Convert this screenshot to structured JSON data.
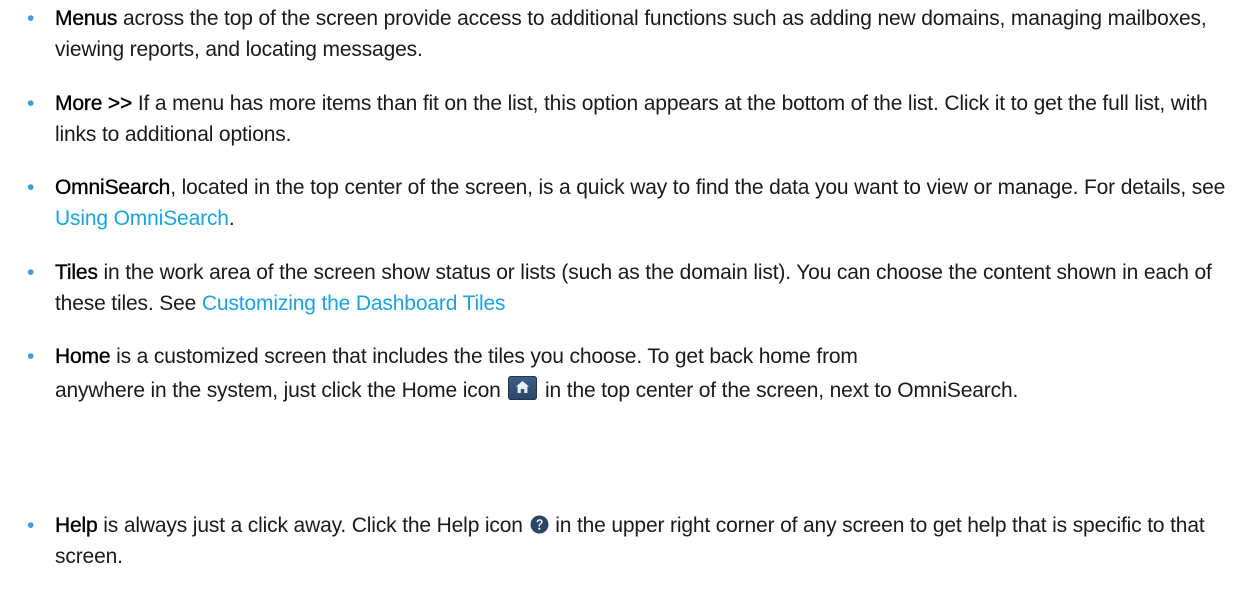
{
  "items": [
    {
      "term": "Menus",
      "text": " across the top of the screen provide access to additional functions such as adding new domains, managing mailboxes, viewing reports, and locating messages."
    },
    {
      "term": "More >>",
      "text": " If a menu has more items than fit on the list, this option appears at the bottom of the list. Click it to get the full list, with links to additional options."
    },
    {
      "term": "OmniSearch",
      "text": ", located in the top center of the screen, is a quick way to find the data you want to view or manage. For details, see ",
      "link": "Using OmniSearch",
      "after": "."
    },
    {
      "term": "Tiles",
      "text": " in the work area of the screen show status or lists (such as the domain list). You can choose the content shown in each of these tiles. See ",
      "link": "Customizing the Dashboard Tiles"
    },
    {
      "term": "Home",
      "text": " is a customized screen that includes the tiles you choose. To get back home from",
      "text2": "anywhere in the system, just click the Home icon ",
      "text3": " in the top center of the screen, next to OmniSearch."
    },
    {
      "term": "Help",
      "text": " is always just a click away. Click the Help icon ",
      "text2": " in the upper right corner of any screen to get help that is specific to that screen."
    }
  ],
  "colors": {
    "bullet": "#3aa0db",
    "link": "#1aa3e0",
    "home_icon_bg": "#3e5f86",
    "help_icon_bg": "#2b4566"
  },
  "icons": {
    "home": "home-icon",
    "help": "help-icon"
  }
}
